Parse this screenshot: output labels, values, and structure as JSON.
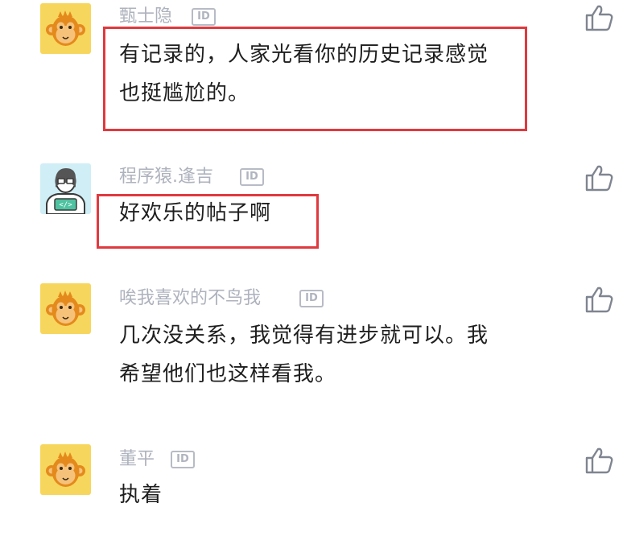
{
  "comments": [
    {
      "username": "甄士隐",
      "id_badge": "ID",
      "lines": [
        "有记录的，人家光看你的历史记录感觉",
        "也挺尴尬的。"
      ],
      "avatar": "monkey-avatar"
    },
    {
      "username": "程序猿.逢吉",
      "id_badge": "ID",
      "lines": [
        "好欢乐的帖子啊"
      ],
      "avatar": "programmer-avatar"
    },
    {
      "username": "唉我喜欢的不鸟我",
      "id_badge": "ID",
      "lines": [
        "几次没关系，我觉得有进步就可以。我",
        "希望他们也这样看我。"
      ],
      "avatar": "monkey-avatar"
    },
    {
      "username": "董平",
      "id_badge": "ID",
      "lines": [
        "执着"
      ],
      "avatar": "monkey-avatar"
    }
  ],
  "icons": {
    "like": "thumbs-up-icon"
  },
  "colors": {
    "username": "#aeb2bd",
    "content": "#1e1e1e",
    "highlight_border": "#e0393e",
    "avatar_bg": "#f7d65d",
    "monkey_face": "#e48a1c",
    "programmer_bg": "#cfeef6"
  }
}
